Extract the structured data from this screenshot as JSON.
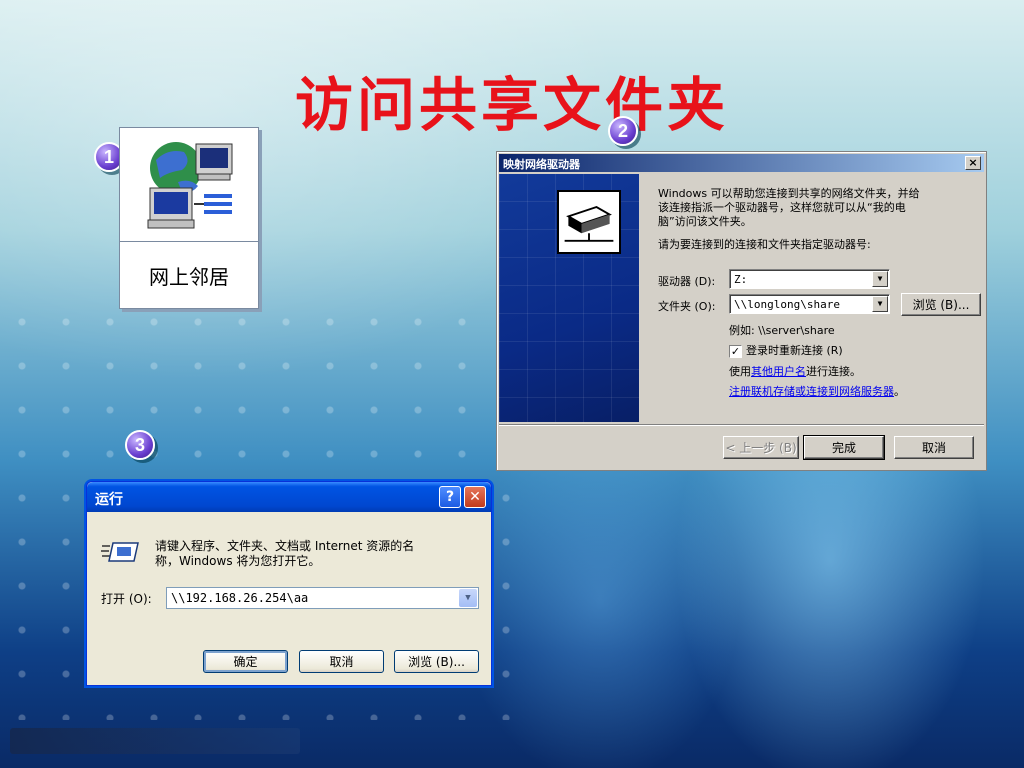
{
  "slide": {
    "title": "访问共享文件夹",
    "badges": [
      "1",
      "2",
      "3"
    ]
  },
  "network_neighborhood": {
    "icon": "network-computers-icon",
    "label": "网上邻居"
  },
  "map_drive_dialog": {
    "title": "映射网络驱动器",
    "close_label": "×",
    "intro_line1": "Windows 可以帮助您连接到共享的网络文件夹，并给",
    "intro_line2": "该连接指派一个驱动器号，这样您就可以从“我的电",
    "intro_line3": "脑”访问该文件夹。",
    "instruction": "请为要连接到的连接和文件夹指定驱动器号:",
    "drive_label": "驱动器 (D):",
    "drive_value": "Z:",
    "folder_label": "文件夹 (O):",
    "folder_value": "\\\\longlong\\share",
    "browse_label": "浏览 (B)...",
    "example": "例如: \\\\server\\share",
    "reconnect_label": "登录时重新连接 (R)",
    "reconnect_checked": "✓",
    "use_prefix": "使用",
    "other_user_link": "其他用户名",
    "use_suffix": "进行连接。",
    "register_link": "注册联机存储或连接到网络服务器",
    "register_suffix": "。",
    "back_label": "< 上一步 (B)",
    "finish_label": "完成",
    "cancel_label": "取消"
  },
  "run_dialog": {
    "title": "运行",
    "help_label": "?",
    "close_label": "✕",
    "desc_line1": "请键入程序、文件夹、文档或 Internet 资源的名",
    "desc_line2": "称，Windows 将为您打开它。",
    "open_label": "打开 (O):",
    "open_value": "\\\\192.168.26.254\\aa",
    "ok_label": "确定",
    "cancel_label": "取消",
    "browse_label": "浏览 (B)..."
  }
}
